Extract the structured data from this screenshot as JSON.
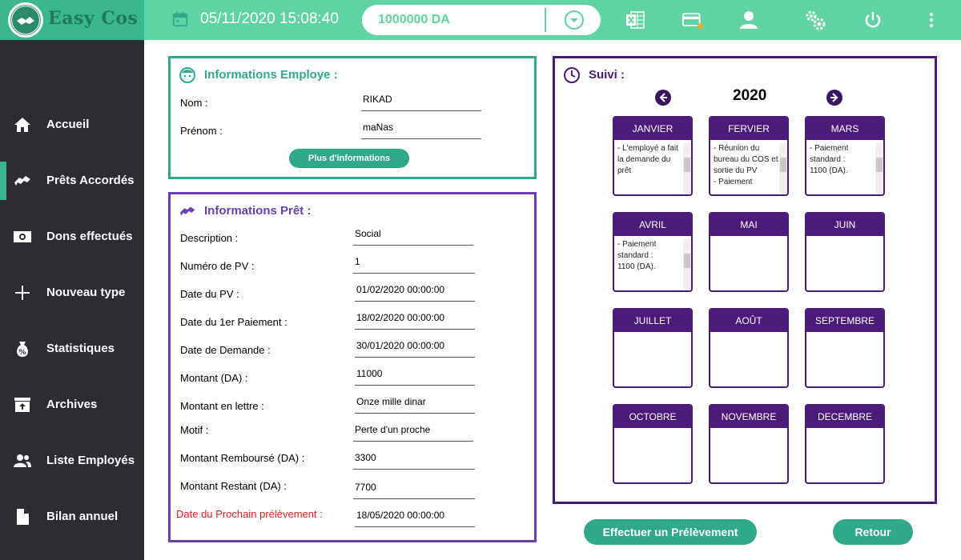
{
  "app": {
    "logo_text": "Easy Cos"
  },
  "topbar": {
    "datetime": "05/11/2020 15:08:40",
    "balance": "1000000 DA",
    "icons": [
      "calendar-icon",
      "chevron-down-circle-icon",
      "excel-icon",
      "card-icon",
      "user-icon",
      "gears-icon",
      "power-icon",
      "more-vert-icon"
    ]
  },
  "sidebar": {
    "items": [
      {
        "label": "Accueil",
        "icon": "home-icon"
      },
      {
        "label": "Prêts Accordés",
        "icon": "handshake-icon",
        "active": true
      },
      {
        "label": "Dons effectués",
        "icon": "money-icon"
      },
      {
        "label": "Nouveau type",
        "icon": "plus-icon"
      },
      {
        "label": "Statistiques",
        "icon": "money-bag-icon"
      },
      {
        "label": "Archives",
        "icon": "archive-icon"
      },
      {
        "label": "Liste Employés",
        "icon": "people-icon"
      },
      {
        "label": "Bilan annuel",
        "icon": "document-icon"
      }
    ]
  },
  "employee": {
    "title": "Informations Employe :",
    "nom_label": "Nom :",
    "nom_value": "RIKAD",
    "prenom_label": "Prénom :",
    "prenom_value": "maNas",
    "more_button": "Plus d'informations"
  },
  "loan": {
    "title": "Informations Prêt :",
    "fields": [
      {
        "label": "Description :",
        "value": "Social"
      },
      {
        "label": "Numéro de PV :",
        "value": "1"
      },
      {
        "label": "Date du PV :",
        "value": "01/02/2020 00:00:00"
      },
      {
        "label": "Date du 1er Paiement :",
        "value": "18/02/2020 00:00:00"
      },
      {
        "label": "Date de Demande :",
        "value": "30/01/2020 00:00:00"
      },
      {
        "label": "Montant (DA) :",
        "value": "11000"
      },
      {
        "label": "Montant en lettre :",
        "value": "Onze mille dinar"
      },
      {
        "label": "Motif :",
        "value": "Perte d'un proche"
      },
      {
        "label": "Montant Remboursé (DA) :",
        "value": "3300"
      },
      {
        "label": "Montant Restant (DA) :",
        "value": "7700"
      },
      {
        "label": "Date du Prochain prélèvement :",
        "value": "18/05/2020 00:00:00"
      }
    ]
  },
  "suivi": {
    "title": "Suivi :",
    "year": "2020",
    "months": [
      {
        "name": "JANVIER",
        "text": "- L'employé a fait la demande du prêt"
      },
      {
        "name": "FERVIER",
        "text": "- Réunion du bureau du COS et sortie du PV\n- Paiement"
      },
      {
        "name": "MARS",
        "text": "- Paiement standard :\n   1100 (DA)."
      },
      {
        "name": "AVRIL",
        "text": "- Paiement standard :\n   1100 (DA)."
      },
      {
        "name": "MAI",
        "text": ""
      },
      {
        "name": "JUIN",
        "text": ""
      },
      {
        "name": "JUILLET",
        "text": ""
      },
      {
        "name": "AOÛT",
        "text": ""
      },
      {
        "name": "SEPTEMBRE",
        "text": ""
      },
      {
        "name": "OCTOBRE",
        "text": ""
      },
      {
        "name": "NOVEMBRE",
        "text": ""
      },
      {
        "name": "DECEMBRE",
        "text": ""
      }
    ]
  },
  "actions": {
    "prelevement": "Effectuer un Prélèvement",
    "retour": "Retour"
  },
  "colors": {
    "topbar": "#5fd3a1",
    "sidebar": "#2b2d33",
    "green_accent": "#2fa98a",
    "purple_accent": "#6a3fb4",
    "dark_purple": "#4b1a7a",
    "alert_red": "#e02020"
  }
}
